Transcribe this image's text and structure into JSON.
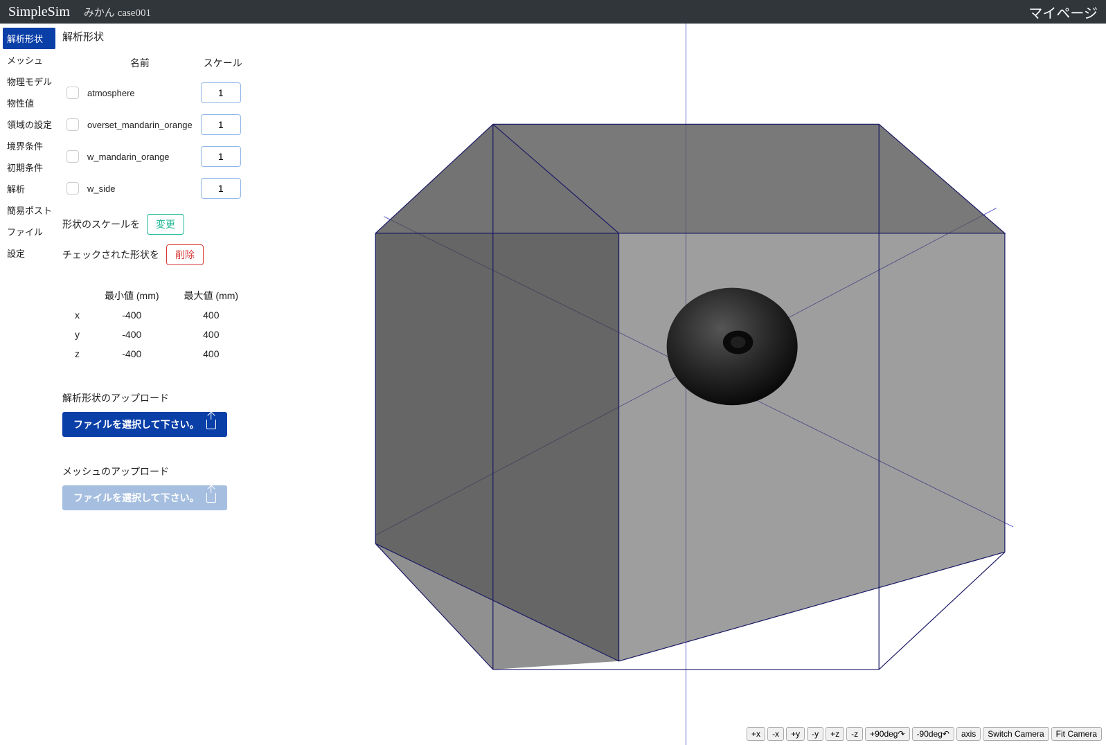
{
  "header": {
    "brand": "SimpleSim",
    "case": "みかん case001",
    "mypage": "マイページ"
  },
  "sidebar": {
    "items": [
      {
        "label": "解析形状",
        "active": true
      },
      {
        "label": "メッシュ"
      },
      {
        "label": "物理モデル"
      },
      {
        "label": "物性値"
      },
      {
        "label": "領域の設定"
      },
      {
        "label": "境界条件"
      },
      {
        "label": "初期条件"
      },
      {
        "label": "解析"
      },
      {
        "label": "簡易ポスト"
      },
      {
        "label": "ファイル"
      },
      {
        "label": "設定"
      }
    ]
  },
  "panel": {
    "title": "解析形状",
    "cols": {
      "name": "名前",
      "scale": "スケール"
    },
    "shapes": [
      {
        "name": "atmosphere",
        "scale": "1"
      },
      {
        "name": "overset_mandarin_orange",
        "scale": "1"
      },
      {
        "name": "w_mandarin_orange",
        "scale": "1"
      },
      {
        "name": "w_side",
        "scale": "1"
      }
    ],
    "scale_action": {
      "label": "形状のスケールを",
      "button": "変更"
    },
    "delete_action": {
      "label": "チェックされた形状を",
      "button": "削除"
    },
    "bounds": {
      "min_header": "最小値 (mm)",
      "max_header": "最大値 (mm)",
      "rows": [
        {
          "axis": "x",
          "min": "-400",
          "max": "400"
        },
        {
          "axis": "y",
          "min": "-400",
          "max": "400"
        },
        {
          "axis": "z",
          "min": "-400",
          "max": "400"
        }
      ]
    },
    "upload_geom": {
      "title": "解析形状のアップロード",
      "button": "ファイルを選択して下さい。"
    },
    "upload_mesh": {
      "title": "メッシュのアップロード",
      "button": "ファイルを選択して下さい。"
    }
  },
  "viewer": {
    "buttons": [
      "+x",
      "-x",
      "+y",
      "-y",
      "+z",
      "-z",
      "+90deg↷",
      "-90deg↶",
      "axis",
      "Switch Camera",
      "Fit Camera"
    ]
  }
}
